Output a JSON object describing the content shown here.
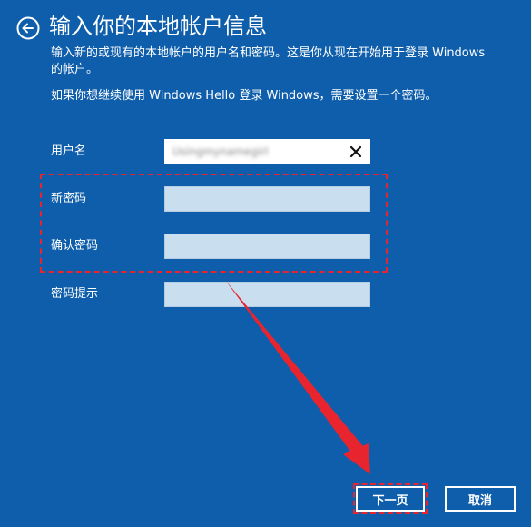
{
  "header": {
    "back_icon": "arrow-left-circle-icon",
    "title": "输入你的本地帐户信息"
  },
  "intro": {
    "description": "输入新的或现有的本地帐户的用户名和密码。这是你从现在开始用于登录 Windows 的帐户。",
    "hello_note": "如果你想继续使用 Windows Hello 登录 Windows，需要设置一个密码。"
  },
  "form": {
    "username": {
      "label": "用户名",
      "value": "Usingmynamegirl",
      "clear_icon": "close-icon"
    },
    "new_password": {
      "label": "新密码",
      "value": ""
    },
    "confirm_password": {
      "label": "确认密码",
      "value": ""
    },
    "password_hint": {
      "label": "密码提示",
      "value": ""
    }
  },
  "buttons": {
    "next_label": "下一页",
    "cancel_label": "取消"
  },
  "colors": {
    "background": "#0f5eab",
    "annotation": "#e8252e",
    "field_inactive": "#c9dff0",
    "field_active": "#ffffff"
  }
}
